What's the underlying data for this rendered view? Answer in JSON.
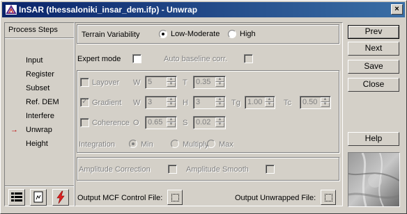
{
  "window": {
    "title": "InSAR (thessaloniki_insar_dem.ifp) - Unwrap",
    "close_glyph": "×"
  },
  "steps": {
    "header": "Process Steps",
    "items": [
      {
        "label": "Input",
        "active": false
      },
      {
        "label": "Register",
        "active": false
      },
      {
        "label": "Subset",
        "active": false
      },
      {
        "label": "Ref. DEM",
        "active": false
      },
      {
        "label": "Interfere",
        "active": false
      },
      {
        "label": "Unwrap",
        "active": true
      },
      {
        "label": "Height",
        "active": false
      }
    ],
    "current_marker": "→"
  },
  "terrain": {
    "label": "Terrain Variability",
    "options": [
      "Low-Moderate",
      "High"
    ],
    "selected": "Low-Moderate"
  },
  "expert": {
    "expert_label": "Expert mode",
    "expert_checked": false,
    "auto_baseline_label": "Auto baseline corr.",
    "auto_baseline_checked": false
  },
  "filters": {
    "layover": {
      "label": "Layover",
      "w_label": "W",
      "w_value": "5",
      "t_label": "T",
      "t_value": "0.35",
      "checked": false
    },
    "gradient": {
      "label": "Gradient",
      "w_label": "W",
      "w_value": "3",
      "h_label": "H",
      "h_value": "3",
      "tg_label": "Tg",
      "tg_value": "1.00",
      "tc_label": "Tc",
      "tc_value": "0.50",
      "checked": true
    },
    "coherence": {
      "label": "Coherence",
      "o_label": "O",
      "o_value": "0.65",
      "s_label": "S",
      "s_value": "0.02",
      "checked": false
    },
    "integration": {
      "label": "Integration",
      "options": [
        "Min",
        "Multiply",
        "Max"
      ],
      "selected": "Min"
    }
  },
  "amplitude": {
    "correction_label": "Amplitude Correction",
    "smooth_label": "Amplitude Smooth"
  },
  "outputs": {
    "mcf_label": "Output MCF Control File:",
    "unwrapped_label": "Output Unwrapped File:"
  },
  "buttons": {
    "prev": "Prev",
    "next": "Next",
    "save": "Save",
    "close": "Close",
    "help": "Help"
  }
}
